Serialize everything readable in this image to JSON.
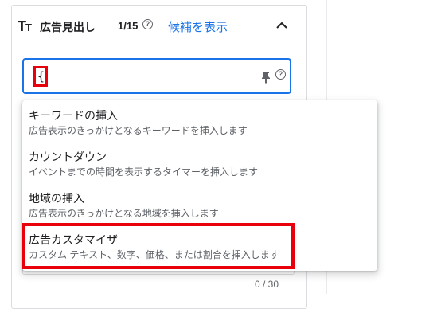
{
  "header": {
    "title": "広告見出し",
    "count": "1/15",
    "help_glyph": "?",
    "show_candidates_label": "候補を表示",
    "icon_big": "T",
    "icon_small": "T"
  },
  "input": {
    "value": "{",
    "help_glyph": "?"
  },
  "dropdown": {
    "items": [
      {
        "title": "キーワードの挿入",
        "description": "広告表示のきっかけとなるキーワードを挿入します"
      },
      {
        "title": "カウントダウン",
        "description": "イベントまでの時間を表示するタイマーを挿入します"
      },
      {
        "title": "地域の挿入",
        "description": "広告表示のきっかけとなる地域を挿入します"
      },
      {
        "title": "広告カスタマイザ",
        "description": "カスタム テキスト、数字、価格、または割合を挿入します"
      }
    ]
  },
  "footer": {
    "char_count": "0 / 30"
  },
  "colors": {
    "accent": "#1a73e8",
    "highlight": "#e8000b",
    "text": "#202124",
    "secondary_text": "#5f6368"
  },
  "icons": [
    "text-format-icon",
    "help-icon",
    "chevron-up-icon",
    "pin-icon"
  ]
}
